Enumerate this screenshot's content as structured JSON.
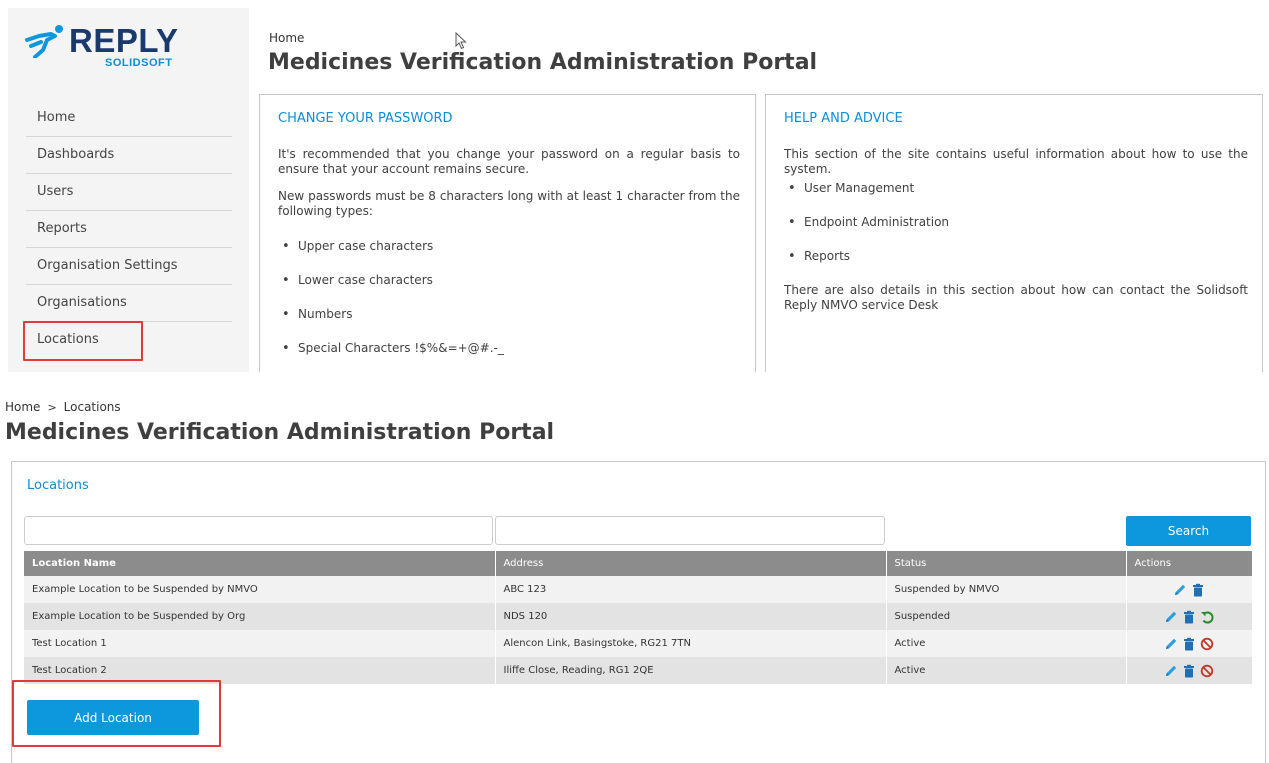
{
  "brand": {
    "name": "REPLY",
    "sub": "SOLIDSOFT"
  },
  "sidebar": {
    "items": [
      {
        "label": "Home"
      },
      {
        "label": "Dashboards"
      },
      {
        "label": "Users"
      },
      {
        "label": "Reports"
      },
      {
        "label": "Organisation Settings"
      },
      {
        "label": "Organisations"
      },
      {
        "label": "Locations"
      }
    ]
  },
  "home": {
    "breadcrumb": "Home",
    "title": "Medicines Verification Administration Portal",
    "password_card": {
      "title": "CHANGE YOUR PASSWORD",
      "intro": "It's recommended that you change your password on a regular basis to ensure that your account remains secure.",
      "rules": "New passwords must be 8 characters long with at least 1 character from the following types:",
      "types": [
        "Upper case characters",
        "Lower case characters",
        "Numbers",
        "Special Characters !$%&=+@#.-_"
      ]
    },
    "help_card": {
      "title": "HELP AND ADVICE",
      "intro": "This section of the site contains useful information about how to use the system.",
      "topics": [
        "User Management",
        "Endpoint Administration",
        "Reports"
      ],
      "outro": "There are also details in this section about how can contact the Solidsoft Reply NMVO service Desk"
    }
  },
  "locations_page": {
    "breadcrumb": {
      "home": "Home",
      "separator": ">",
      "current": "Locations"
    },
    "title": "Medicines Verification Administration Portal",
    "panel_title": "Locations",
    "filters": {
      "name_value": "",
      "address_value": ""
    },
    "search_label": "Search",
    "columns": [
      "Location Name",
      "Address",
      "Status",
      "Actions"
    ],
    "rows": [
      {
        "name": "Example Location to be Suspended by NMVO",
        "address": "ABC 123",
        "status": "Suspended by NMVO",
        "actions": [
          "edit",
          "delete"
        ]
      },
      {
        "name": "Example Location to be Suspended by Org",
        "address": "NDS 120",
        "status": "Suspended",
        "actions": [
          "edit",
          "delete",
          "restore"
        ]
      },
      {
        "name": "Test Location 1",
        "address": "Alencon Link, Basingstoke, RG21 7TN",
        "status": "Active",
        "actions": [
          "edit",
          "delete",
          "suspend"
        ]
      },
      {
        "name": "Test Location 2",
        "address": "Iliffe Close, Reading, RG1 2QE",
        "status": "Active",
        "actions": [
          "edit",
          "delete",
          "suspend"
        ]
      }
    ],
    "add_label": "Add Location"
  },
  "icons": {
    "edit": "pencil-icon",
    "delete": "trash-icon",
    "restore": "undo-icon",
    "suspend": "ban-icon"
  },
  "colors": {
    "accent": "#0d98dd",
    "link": "#0d8cd8",
    "header_grey": "#8c8c8c",
    "highlight": "#e23a3a",
    "restore": "#2a8a2a",
    "suspend": "#c0392b",
    "brand_navy": "#1a3a6e"
  }
}
